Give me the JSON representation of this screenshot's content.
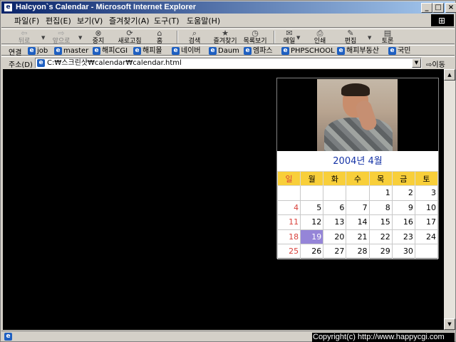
{
  "window": {
    "title": "Halcyon`s Calendar - Microsoft Internet Explorer",
    "minimize_label": "_",
    "maximize_label": "□",
    "close_label": "×"
  },
  "menu": [
    "파일(F)",
    "편집(E)",
    "보기(V)",
    "즐겨찾기(A)",
    "도구(T)",
    "도움말(H)"
  ],
  "toolbar": {
    "back": "뒤로",
    "forward": "앞으로",
    "stop": "중지",
    "refresh": "새로고침",
    "home": "홈",
    "search": "검색",
    "favorites": "즐겨찾기",
    "history": "목록보기",
    "mail": "메일",
    "print": "인쇄",
    "edit": "편집",
    "discuss": "토론"
  },
  "links": {
    "label": "연결",
    "items": [
      "job",
      "master",
      "해피CGI",
      "해피몰",
      "네이버",
      "Daum",
      "엠파스",
      "PHPSCHOOL",
      "해피부동산",
      "국민"
    ]
  },
  "address": {
    "label": "주소(D)",
    "url": "C:₩스크린샷₩calendar₩calendar.html",
    "go": "이동"
  },
  "calendar": {
    "title": "2004년 4월",
    "weekdays": [
      "일",
      "월",
      "화",
      "수",
      "목",
      "금",
      "토"
    ],
    "weeks": [
      [
        "",
        "",
        "",
        "",
        "1",
        "2",
        "3"
      ],
      [
        "4",
        "5",
        "6",
        "7",
        "8",
        "9",
        "10"
      ],
      [
        "11",
        "12",
        "13",
        "14",
        "15",
        "16",
        "17"
      ],
      [
        "18",
        "19",
        "20",
        "21",
        "22",
        "23",
        "24"
      ],
      [
        "25",
        "26",
        "27",
        "28",
        "29",
        "30",
        ""
      ]
    ],
    "today": "19",
    "colors": {
      "header_bg": "#f8cf3a",
      "sunday": "#d8403a",
      "today_bg": "#9585d8",
      "title": "#1533a6"
    }
  },
  "status": {
    "copyright": "Copyright(c) http://www.happycgi.com"
  }
}
